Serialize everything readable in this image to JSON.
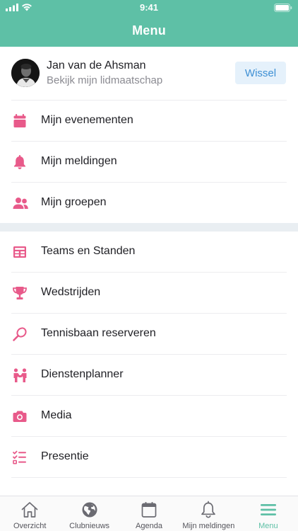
{
  "status_bar": {
    "time": "9:41"
  },
  "header": {
    "title": "Menu"
  },
  "profile": {
    "name": "Jan van de Ahsman",
    "subtitle": "Bekijk mijn lidmaatschap",
    "switch_label": "Wissel"
  },
  "menu": {
    "group1": [
      {
        "label": "Mijn evenementen",
        "icon": "calendar-icon"
      },
      {
        "label": "Mijn meldingen",
        "icon": "bell-icon"
      },
      {
        "label": "Mijn groepen",
        "icon": "group-icon"
      }
    ],
    "group2": [
      {
        "label": "Teams en Standen",
        "icon": "table-icon"
      },
      {
        "label": "Wedstrijden",
        "icon": "trophy-icon"
      },
      {
        "label": "Tennisbaan reserveren",
        "icon": "racket-icon"
      },
      {
        "label": "Dienstenplanner",
        "icon": "volunteers-icon"
      },
      {
        "label": "Media",
        "icon": "camera-icon"
      },
      {
        "label": "Presentie",
        "icon": "checklist-icon"
      }
    ]
  },
  "tabbar": {
    "tabs": [
      {
        "label": "Overzicht",
        "icon": "home-icon",
        "active": false
      },
      {
        "label": "Clubnieuws",
        "icon": "globe-icon",
        "active": false
      },
      {
        "label": "Agenda",
        "icon": "calendar-icon",
        "active": false
      },
      {
        "label": "Mijn meldingen",
        "icon": "bell-icon",
        "active": false
      },
      {
        "label": "Menu",
        "icon": "hamburger-icon",
        "active": true
      }
    ]
  },
  "colors": {
    "header": "#5ec0a6",
    "icon_pink": "#e85a8a",
    "active_tab": "#5ec0a6",
    "switch_text": "#3d8fd4"
  }
}
